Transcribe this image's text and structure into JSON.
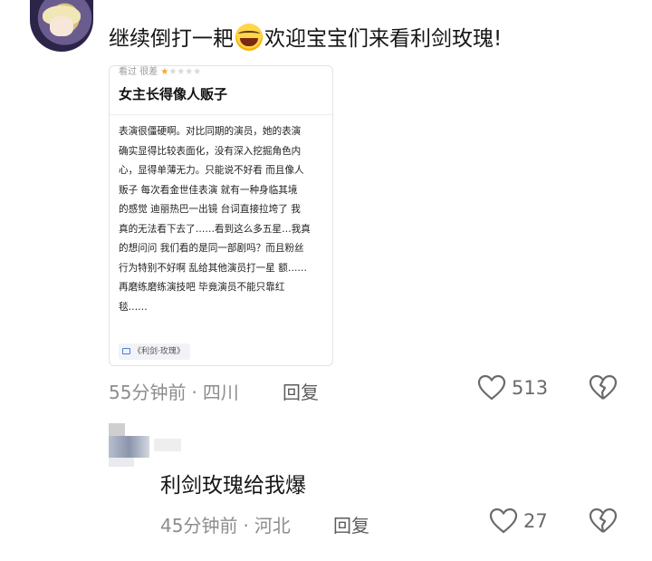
{
  "comment": {
    "text_before_emoji": "继续倒打一耙",
    "emoji": "laughing-crying-emoji",
    "text_after_emoji": "欢迎宝宝们来看利剑玫瑰!",
    "review_card": {
      "top_label": "看过",
      "rating_word": "很差",
      "rating_stars": "1/5",
      "title": "女主长得像人贩子",
      "body": "表演很僵硬啊。对比同期的演员，她的表演\n确实显得比较表面化，没有深入挖掘角色内\n心，显得单薄无力。只能说不好看 而且像人\n贩子 每次看金世佳表演 就有一种身临其境\n的感觉 迪丽热巴一出镜 台词直接拉垮了 我\n真的无法看下去了……看到这么多五星…我真\n的想问问 我们看的是同一部剧吗？而且粉丝\n行为特别不好啊 乱给其他演员打一星 额……\n再磨练磨练演技吧 毕竟演员不能只靠红\n毯……",
      "tag": "《利剑·玫瑰》"
    },
    "time": "55分钟前",
    "location": "四川",
    "separator": "·",
    "reply_label": "回复",
    "like_count": "513"
  },
  "sub_comment": {
    "text": "利剑玫瑰给我爆",
    "time": "45分钟前",
    "location": "河北",
    "separator": "·",
    "reply_label": "回复",
    "like_count": "27"
  },
  "colors": {
    "text": "#161616",
    "meta": "#8d8d8d",
    "star": "#f5a623",
    "icon": "#6a6a6a"
  }
}
